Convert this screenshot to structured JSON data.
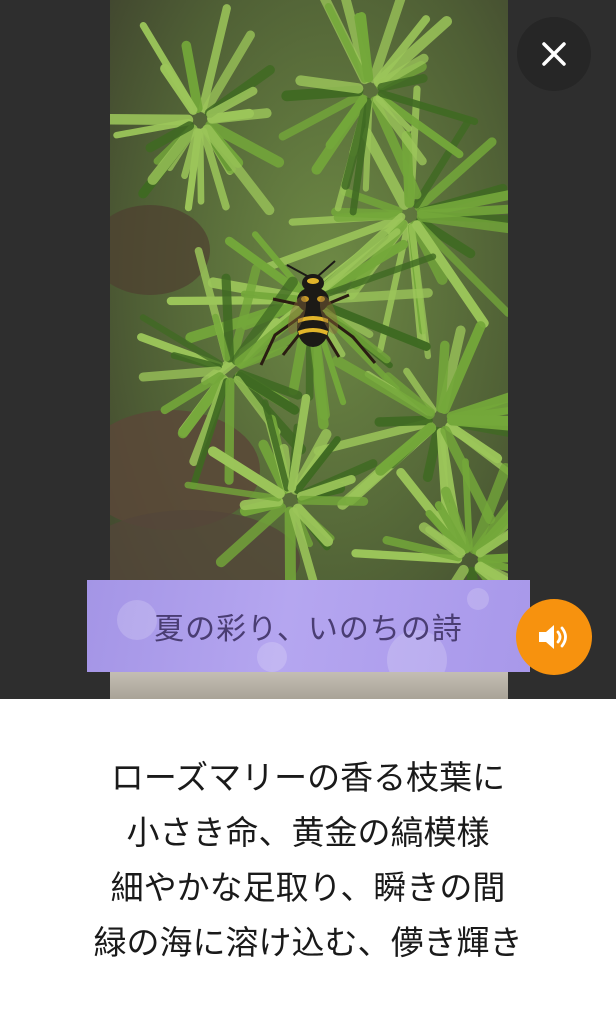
{
  "photo": {
    "subject_icon": "hornet-on-rosemary-photo",
    "palette": {
      "leaf_light": "#9cc65a",
      "leaf_mid": "#74a83a",
      "leaf_dark": "#3f6a22",
      "soil": "#5a4838",
      "insect_body": "#1c1a16",
      "insect_stripe": "#e2b52a"
    }
  },
  "close_button": {
    "icon": "close-icon",
    "background": "#262626"
  },
  "title_banner": {
    "text": "夏の彩り、いのちの詩",
    "background": "#ac9eec",
    "text_color": "#4a3d73"
  },
  "audio_button": {
    "icon": "speaker-icon",
    "background": "#f7920e"
  },
  "poem": {
    "lines": [
      "ローズマリーの香る枝葉に",
      "小さき命、黄金の縞模様",
      "細やかな足取り、瞬きの間",
      "緑の海に溶け込む、儚き輝き"
    ]
  }
}
